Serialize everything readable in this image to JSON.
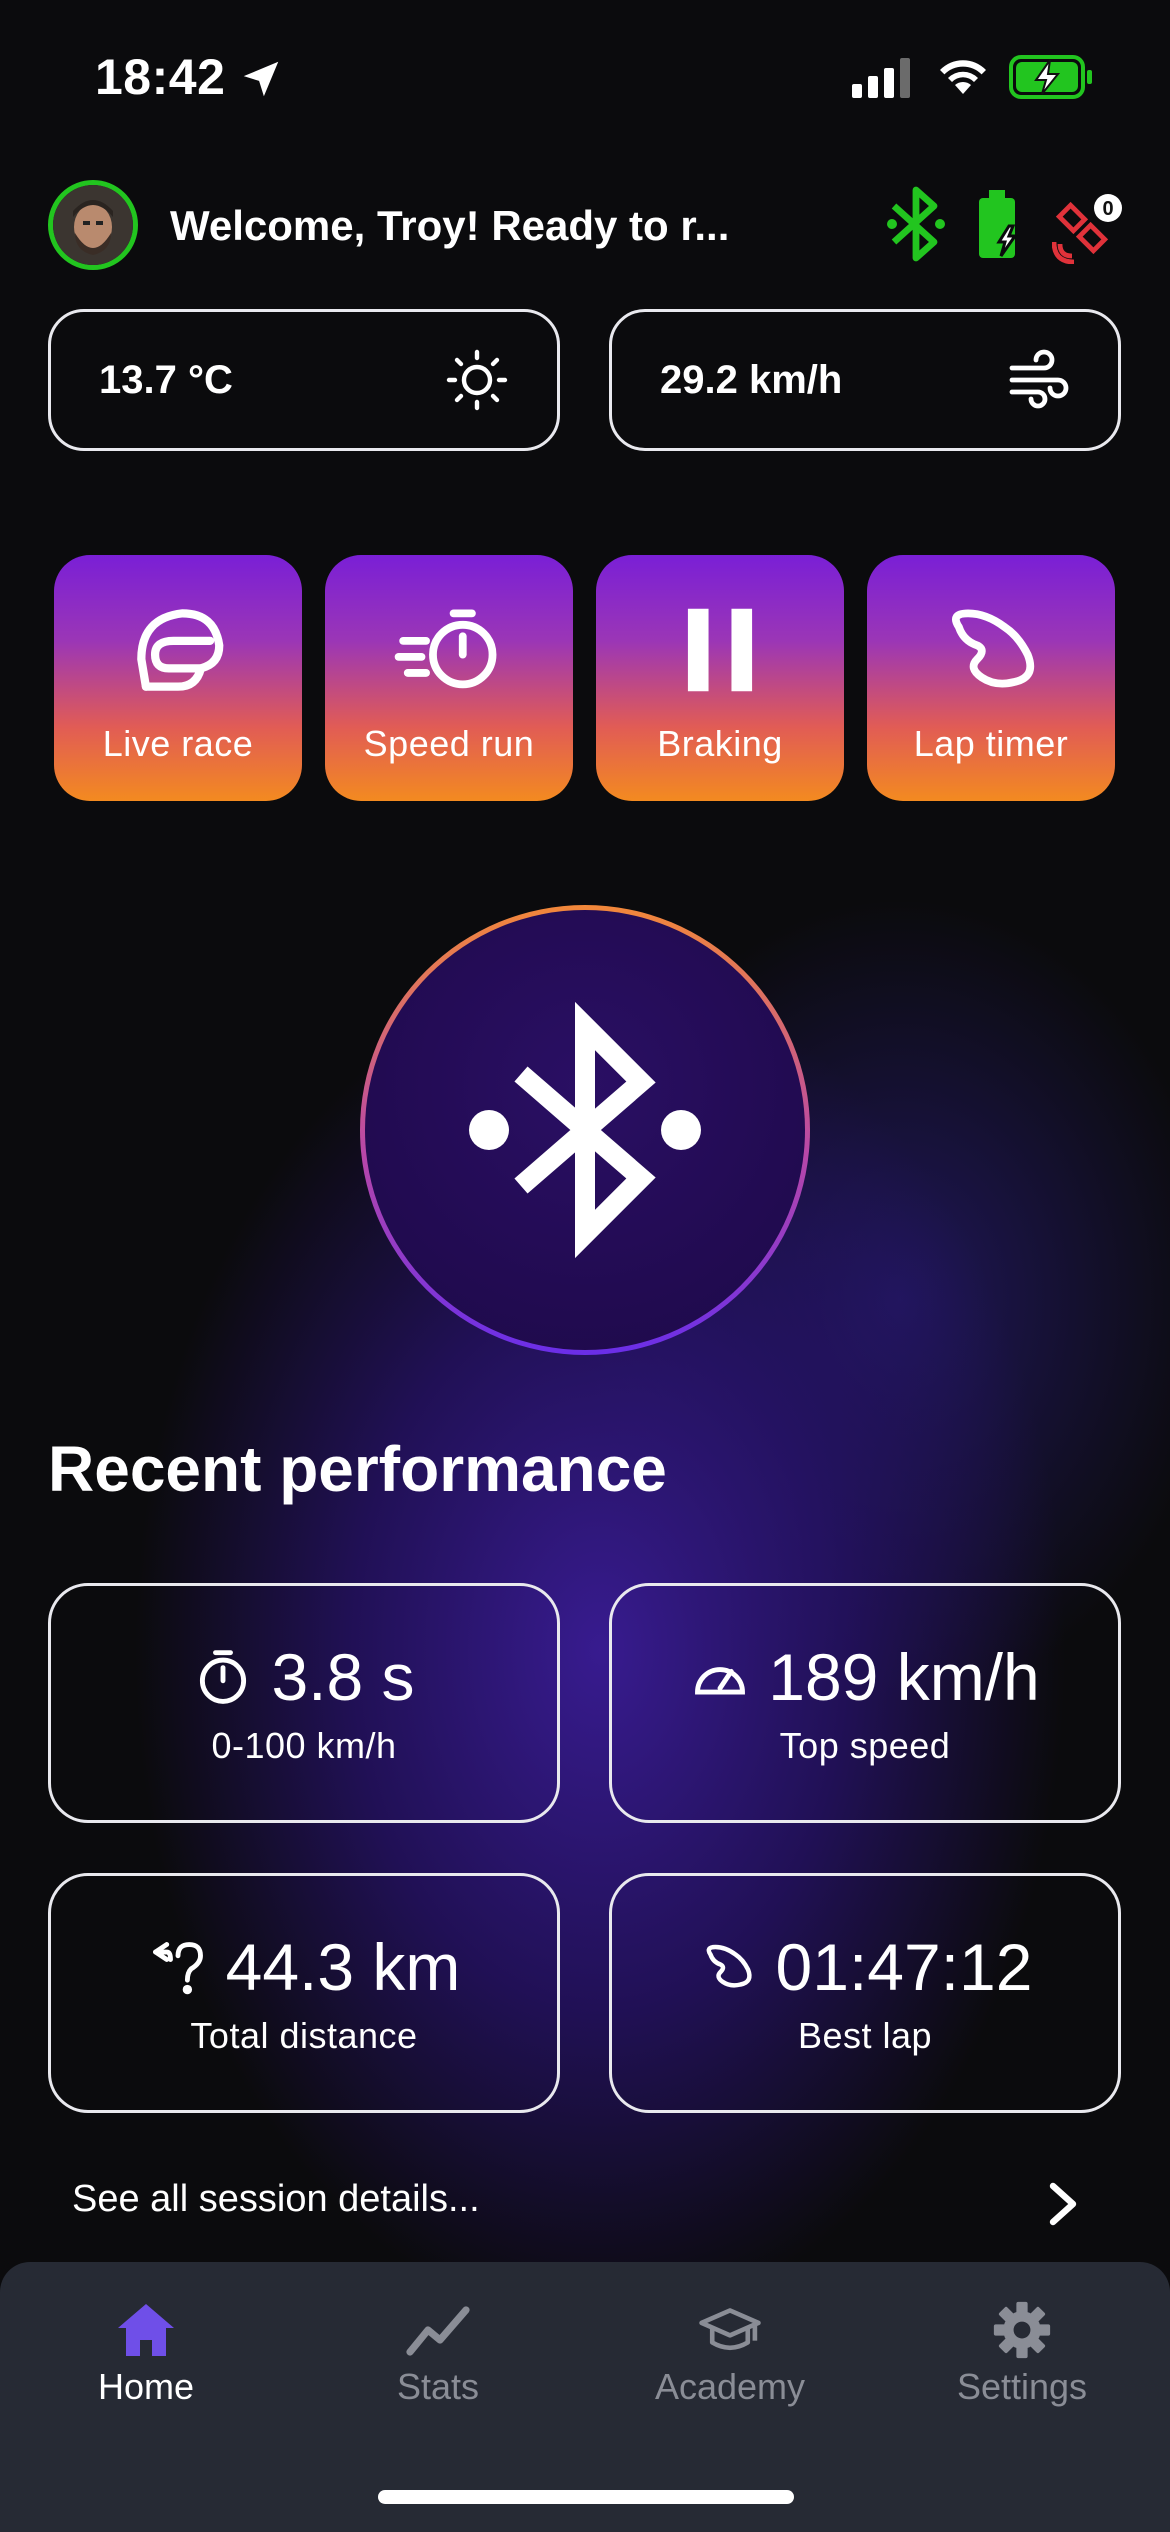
{
  "status_bar": {
    "time": "18:42"
  },
  "header": {
    "welcome": "Welcome, Troy! Ready to r...",
    "colors": {
      "connected": "#22c51f",
      "error": "#e0323a"
    },
    "satellite_count": "0"
  },
  "weather": {
    "temperature": "13.7 °C",
    "wind": "29.2 km/h"
  },
  "modes": [
    {
      "label": "Live race",
      "icon": "helmet-icon"
    },
    {
      "label": "Speed run",
      "icon": "stopwatch-speed-icon"
    },
    {
      "label": "Braking",
      "icon": "pause-bars-icon"
    },
    {
      "label": "Lap timer",
      "icon": "track-icon"
    }
  ],
  "recent": {
    "title": "Recent performance",
    "cards": [
      {
        "value": "3.8 s",
        "label": "0-100 km/h",
        "icon": "stopwatch-icon"
      },
      {
        "value": "189 km/h",
        "label": "Top speed",
        "icon": "speedometer-icon"
      },
      {
        "value": "44.3 km",
        "label": "Total distance",
        "icon": "route-icon"
      },
      {
        "value": "01:47:12",
        "label": "Best lap",
        "icon": "track-icon"
      }
    ],
    "see_all": "See all session details..."
  },
  "tabs": [
    {
      "label": "Home",
      "icon": "home-icon",
      "active": true
    },
    {
      "label": "Stats",
      "icon": "chart-line-icon",
      "active": false
    },
    {
      "label": "Academy",
      "icon": "graduation-cap-icon",
      "active": false
    },
    {
      "label": "Settings",
      "icon": "gear-icon",
      "active": false
    }
  ],
  "accent": "#6f4fe8"
}
